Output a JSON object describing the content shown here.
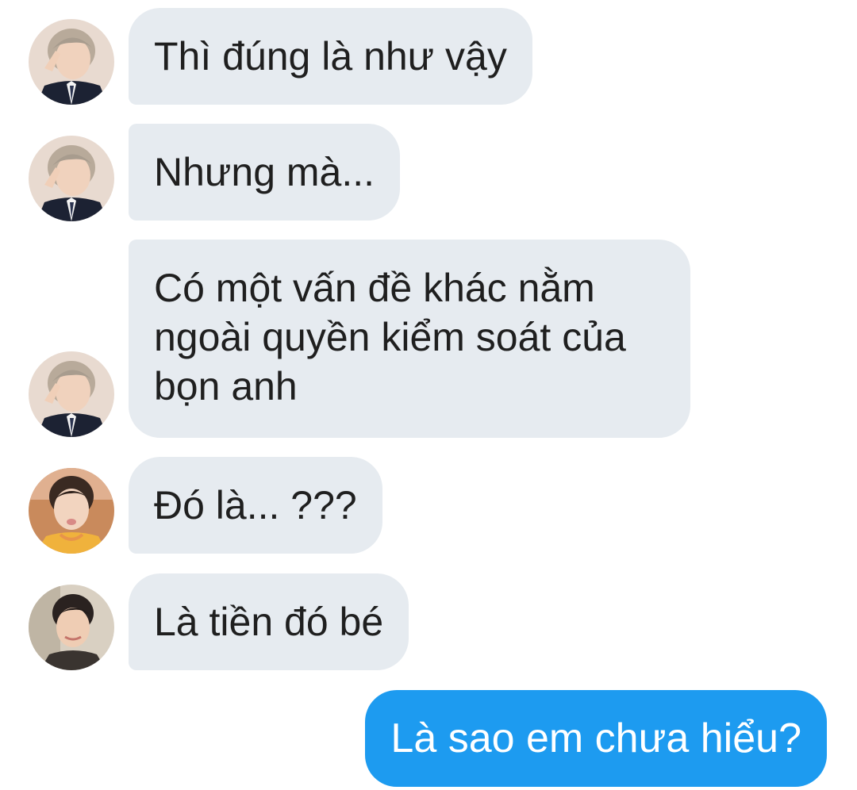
{
  "conversation": {
    "messages": [
      {
        "sender": "rm",
        "text": "Thì đúng là như vậy"
      },
      {
        "sender": "rm",
        "text": "Nhưng mà..."
      },
      {
        "sender": "rm",
        "text": "Có một vấn đề khác nằm ngoài quyền kiểm soát của bọn anh"
      },
      {
        "sender": "jin_orange",
        "text": "Đó là... ???"
      },
      {
        "sender": "jin_dark",
        "text": "Là tiền đó bé"
      },
      {
        "sender": "me",
        "text": "Là sao em chưa hiểu?"
      }
    ]
  },
  "colors": {
    "incoming_bubble": "#e6ebf0",
    "outgoing_bubble": "#1d9bf0",
    "incoming_text": "#1f1f1f",
    "outgoing_text": "#ffffff"
  }
}
